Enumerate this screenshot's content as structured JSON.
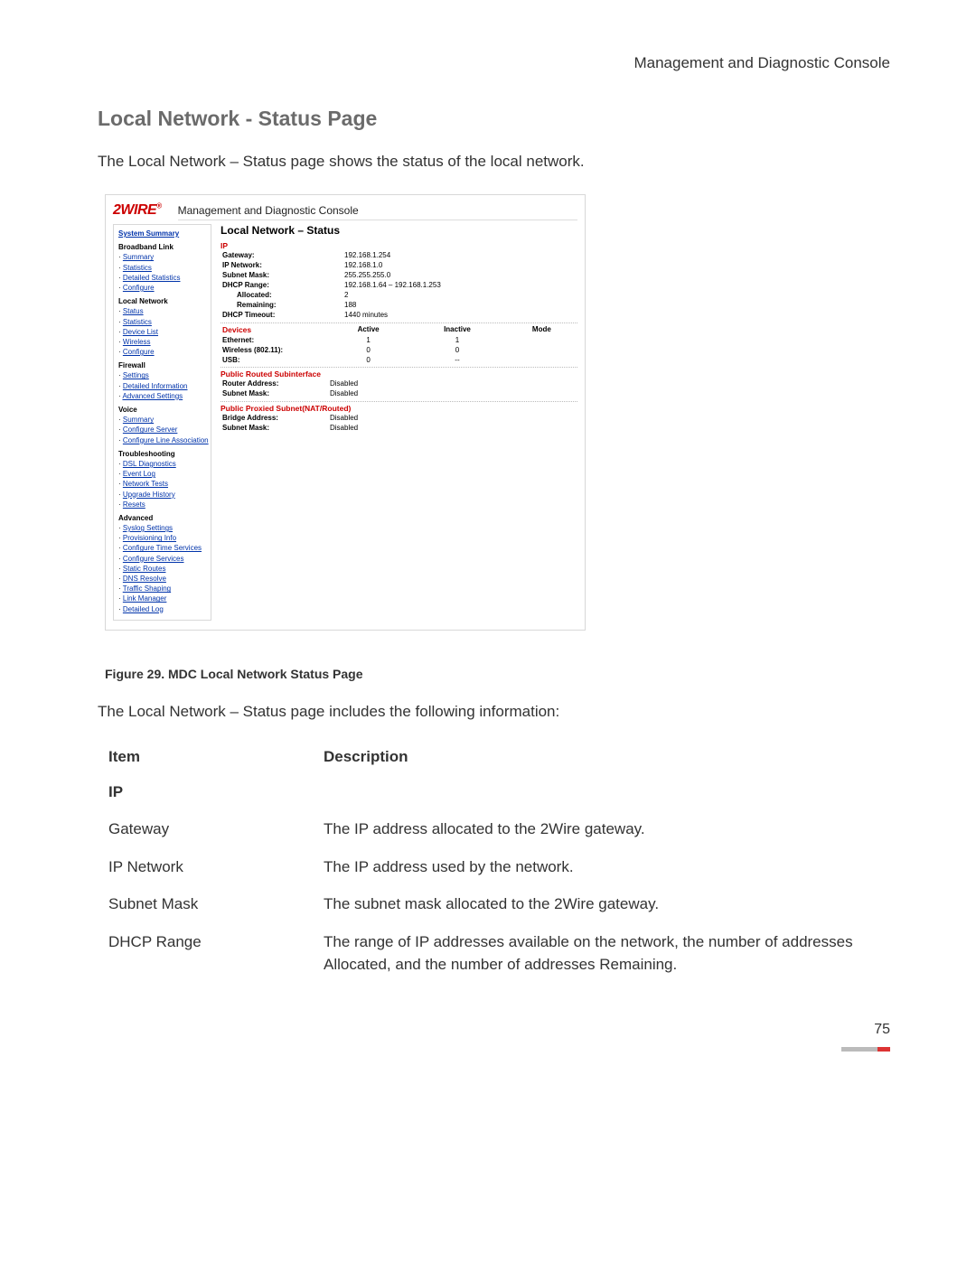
{
  "page_header": "Management and Diagnostic Console",
  "section_title": "Local Network - Status Page",
  "intro_text": "The Local Network – Status page shows the status of the local network.",
  "logo_text": "2WIRE",
  "console_title": "Management and Diagnostic Console",
  "content_title": "Local Network – Status",
  "nav": {
    "system_summary": "System Summary",
    "groups": [
      {
        "label": "Broadband Link",
        "items": [
          "Summary",
          "Statistics",
          "Detailed Statistics",
          "Configure"
        ]
      },
      {
        "label": "Local Network",
        "items": [
          "Status",
          "Statistics",
          "Device List",
          "Wireless",
          "Configure"
        ]
      },
      {
        "label": "Firewall",
        "items": [
          "Settings",
          "Detailed Information",
          "Advanced Settings"
        ]
      },
      {
        "label": "Voice",
        "items": [
          "Summary",
          "Configure Server",
          "Configure Line Association"
        ]
      },
      {
        "label": "Troubleshooting",
        "items": [
          "DSL Diagnostics",
          "Event Log",
          "Network Tests",
          "Upgrade History",
          "Resets"
        ]
      },
      {
        "label": "Advanced",
        "items": [
          "Syslog Settings",
          "Provisioning Info",
          "Configure Time Services",
          "Configure Services",
          "Static Routes",
          "DNS Resolve",
          "Traffic Shaping",
          "Link Manager",
          "Detailed Log"
        ]
      }
    ]
  },
  "ip_section": {
    "heading": "IP",
    "rows": [
      {
        "label": "Gateway:",
        "value": "192.168.1.254"
      },
      {
        "label": "IP Network:",
        "value": "192.168.1.0"
      },
      {
        "label": "Subnet Mask:",
        "value": "255.255.255.0"
      },
      {
        "label": "DHCP Range:",
        "value": "192.168.1.64 – 192.168.1.253"
      },
      {
        "label": "Allocated:",
        "value": "2",
        "indent": true
      },
      {
        "label": "Remaining:",
        "value": "188",
        "indent": true
      },
      {
        "label": "DHCP Timeout:",
        "value": "1440 minutes"
      }
    ]
  },
  "devices_section": {
    "heading": "Devices",
    "cols": [
      "Active",
      "Inactive",
      "Mode"
    ],
    "rows": [
      {
        "label": "Ethernet:",
        "active": "1",
        "inactive": "1",
        "mode": ""
      },
      {
        "label": "Wireless (802.11):",
        "active": "0",
        "inactive": "0",
        "mode": ""
      },
      {
        "label": "USB:",
        "active": "0",
        "inactive": "--",
        "mode": ""
      }
    ]
  },
  "routed_section": {
    "heading": "Public Routed Subinterface",
    "rows": [
      {
        "label": "Router Address:",
        "value": "Disabled"
      },
      {
        "label": "Subnet Mask:",
        "value": "Disabled"
      }
    ]
  },
  "proxied_section": {
    "heading": "Public Proxied Subnet(NAT/Routed)",
    "rows": [
      {
        "label": "Bridge Address:",
        "value": "Disabled"
      },
      {
        "label": "Subnet Mask:",
        "value": "Disabled"
      }
    ]
  },
  "figure_caption": "Figure 29. MDC Local Network Status Page",
  "info_lead": "The Local Network – Status page includes the following information:",
  "desc_table": {
    "header": [
      "Item",
      "Description"
    ],
    "subhead": "IP",
    "rows": [
      {
        "item": "Gateway",
        "desc": "The IP address allocated to the 2Wire gateway."
      },
      {
        "item": "IP Network",
        "desc": "The IP address used by the network."
      },
      {
        "item": "Subnet Mask",
        "desc": "The subnet mask allocated to the 2Wire gateway."
      },
      {
        "item": "DHCP Range",
        "desc": "The range of IP addresses available on the network, the number of addresses Allocated, and the number of addresses Remaining."
      }
    ]
  },
  "page_number": "75"
}
